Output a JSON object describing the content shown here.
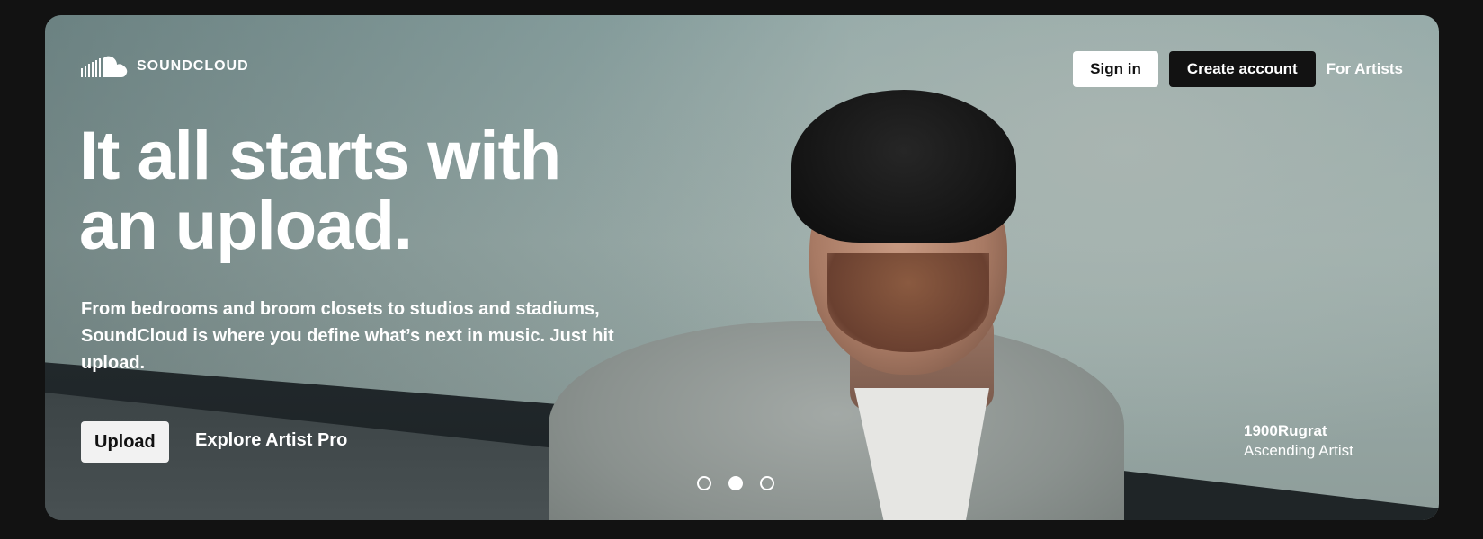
{
  "brand": {
    "name": "SOUNDCLOUD",
    "icon": "soundcloud-logo-icon"
  },
  "nav": {
    "signin_label": "Sign in",
    "create_label": "Create account",
    "artists_label": "For Artists"
  },
  "hero": {
    "headline": "It all starts with an upload.",
    "subtext": "From bedrooms and broom closets to studios and stadiums, SoundCloud is where you define what’s next in music. Just hit upload.",
    "upload_label": "Upload",
    "explore_label": "Explore Artist Pro",
    "artist_name": "1900Rugrat",
    "artist_role": "Ascending Artist",
    "carousel": {
      "count": 3,
      "active_index": 1
    }
  },
  "colors": {
    "background": "#121212",
    "primary_button": "#ffffff",
    "dark_button": "#121212"
  }
}
